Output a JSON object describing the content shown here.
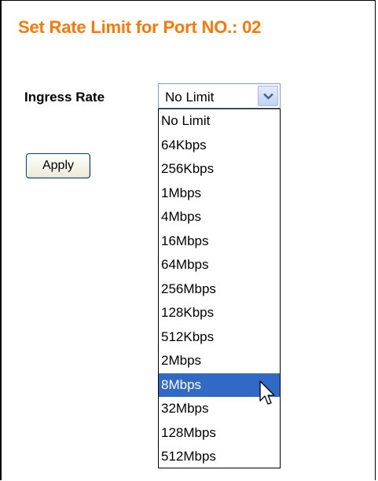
{
  "page": {
    "title": "Set Rate Limit for Port NO.: 02"
  },
  "form": {
    "ingress_label": "Ingress Rate",
    "selected_value": "No Limit",
    "apply_label": "Apply"
  },
  "dropdown": {
    "highlighted_index": 11,
    "options": [
      "No Limit",
      "64Kbps",
      "256Kbps",
      "1Mbps",
      "4Mbps",
      "16Mbps",
      "64Mbps",
      "256Mbps",
      "128Kbps",
      "512Kbps",
      "2Mbps",
      "8Mbps",
      "32Mbps",
      "128Mbps",
      "512Mbps"
    ]
  },
  "colors": {
    "title": "#ff7700",
    "highlight": "#316ac5",
    "highlight_text": "#ffffff"
  },
  "icons": {
    "select_arrow": "chevron-down-icon",
    "pointer": "mouse-pointer-icon"
  }
}
